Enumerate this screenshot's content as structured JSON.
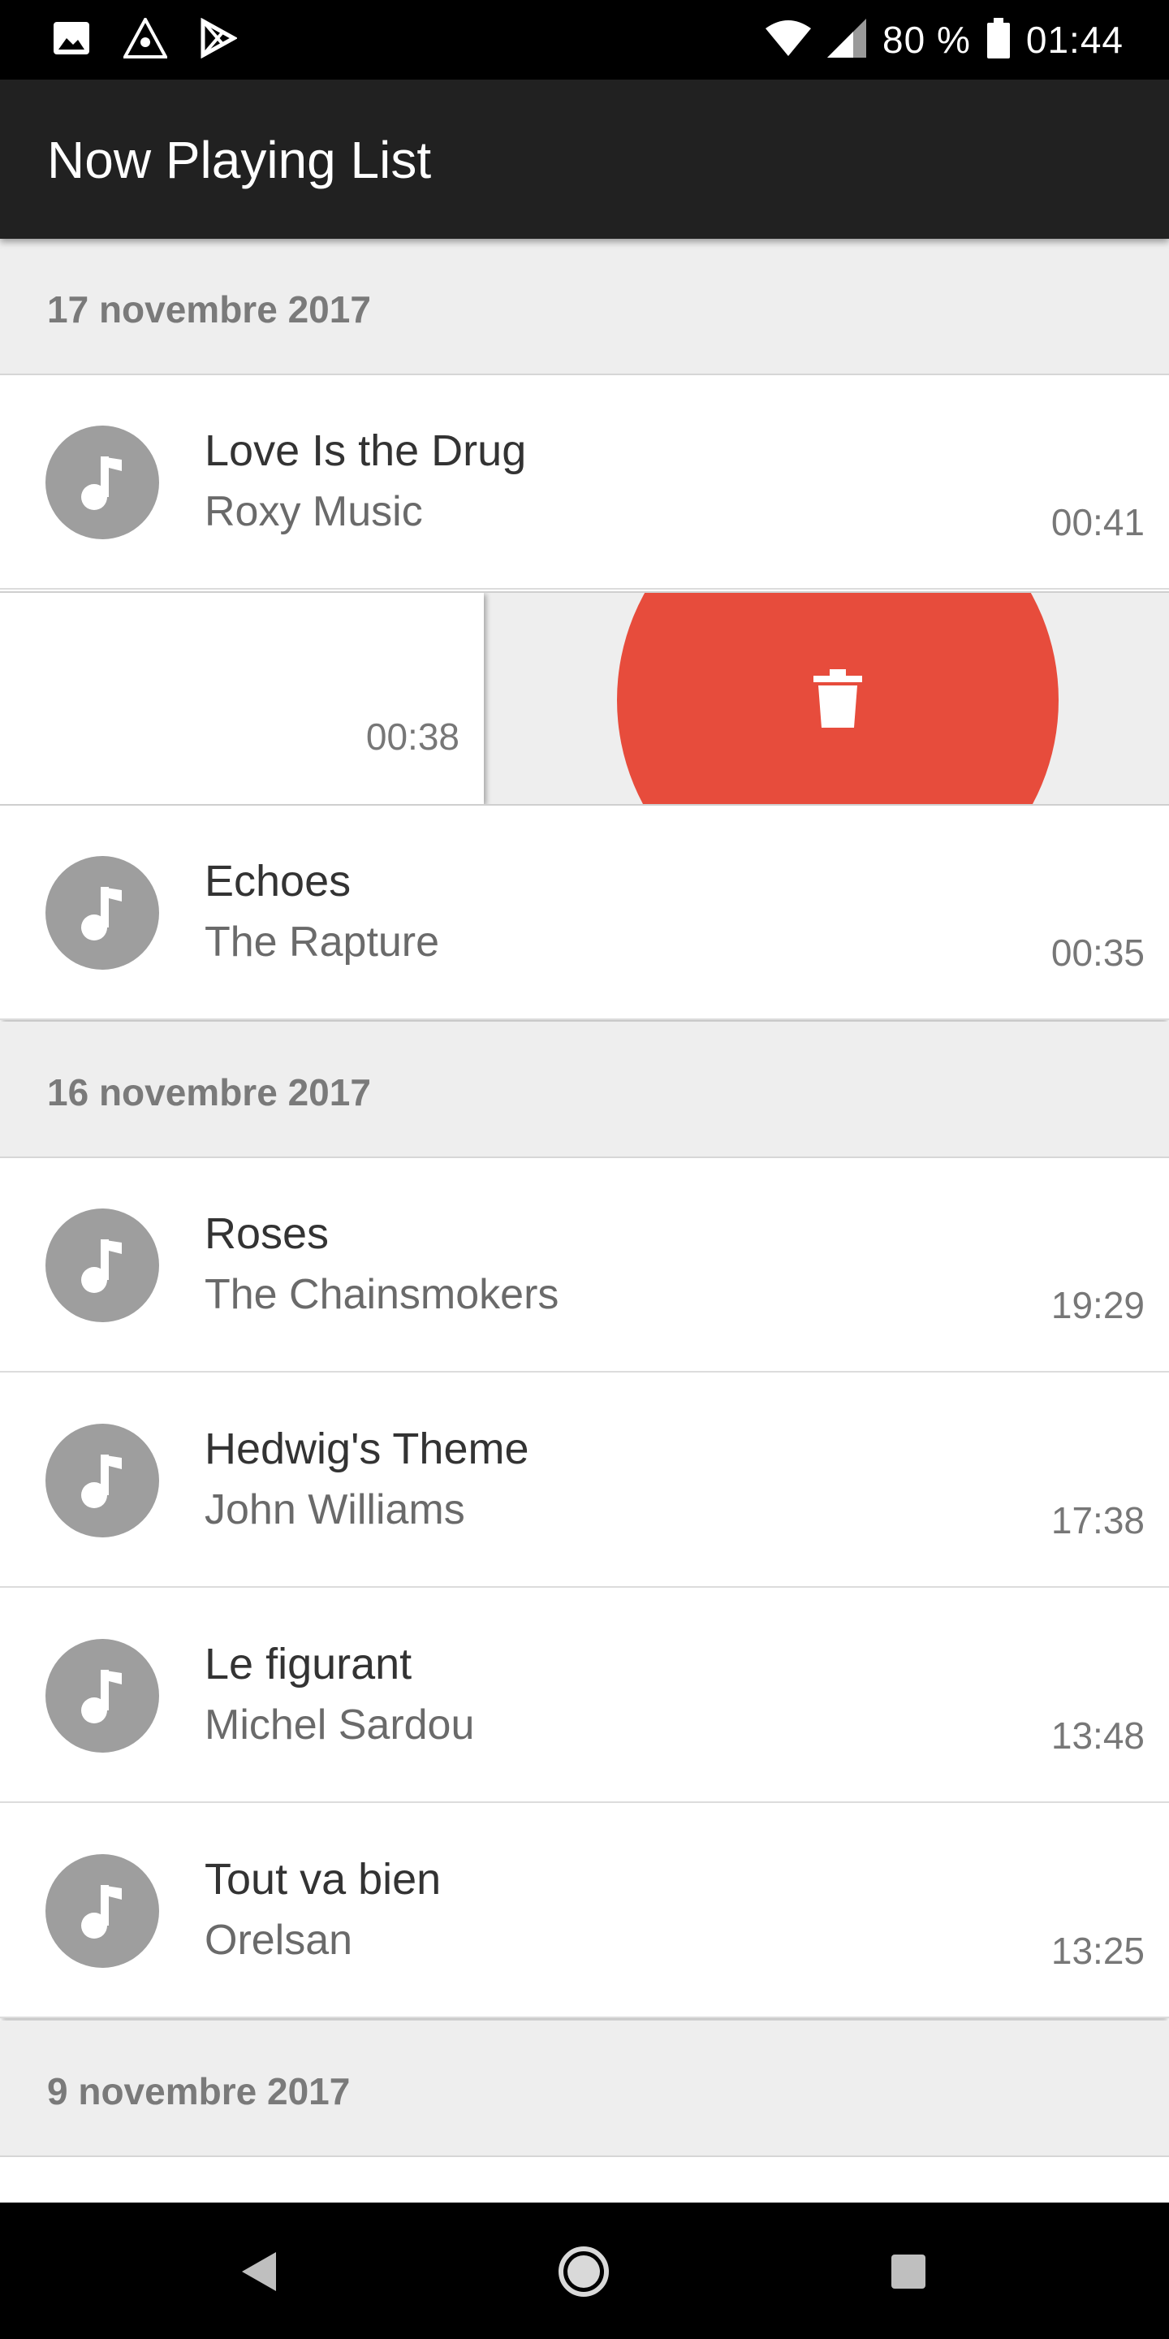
{
  "status": {
    "battery": "80 %",
    "time": "01:44",
    "icons": [
      "image-icon",
      "triangle-app-icon",
      "play-store-icon",
      "wifi-icon",
      "signal-icon",
      "battery-icon"
    ]
  },
  "app_bar": {
    "title": "Now Playing List"
  },
  "sections": [
    {
      "date": "17 novembre 2017",
      "items": [
        {
          "song": "Love Is the Drug",
          "artist": "Roxy Music",
          "time": "00:41"
        },
        {
          "song": "",
          "artist": "",
          "time": "00:38",
          "swiped": true
        },
        {
          "song": "Echoes",
          "artist": "The Rapture",
          "time": "00:35"
        }
      ]
    },
    {
      "date": "16 novembre 2017",
      "items": [
        {
          "song": "Roses",
          "artist": "The Chainsmokers",
          "time": "19:29"
        },
        {
          "song": "Hedwig's Theme",
          "artist": "John Williams",
          "time": "17:38"
        },
        {
          "song": "Le figurant",
          "artist": "Michel Sardou",
          "time": "13:48"
        },
        {
          "song": "Tout va bien",
          "artist": "Orelsan",
          "time": "13:25"
        }
      ]
    },
    {
      "date": "9 novembre 2017",
      "items": []
    }
  ],
  "colors": {
    "delete": "#e74c3c",
    "app_bar": "#212121",
    "avatar": "#9e9e9e"
  },
  "nav": [
    "back-icon",
    "home-icon",
    "recents-icon"
  ]
}
